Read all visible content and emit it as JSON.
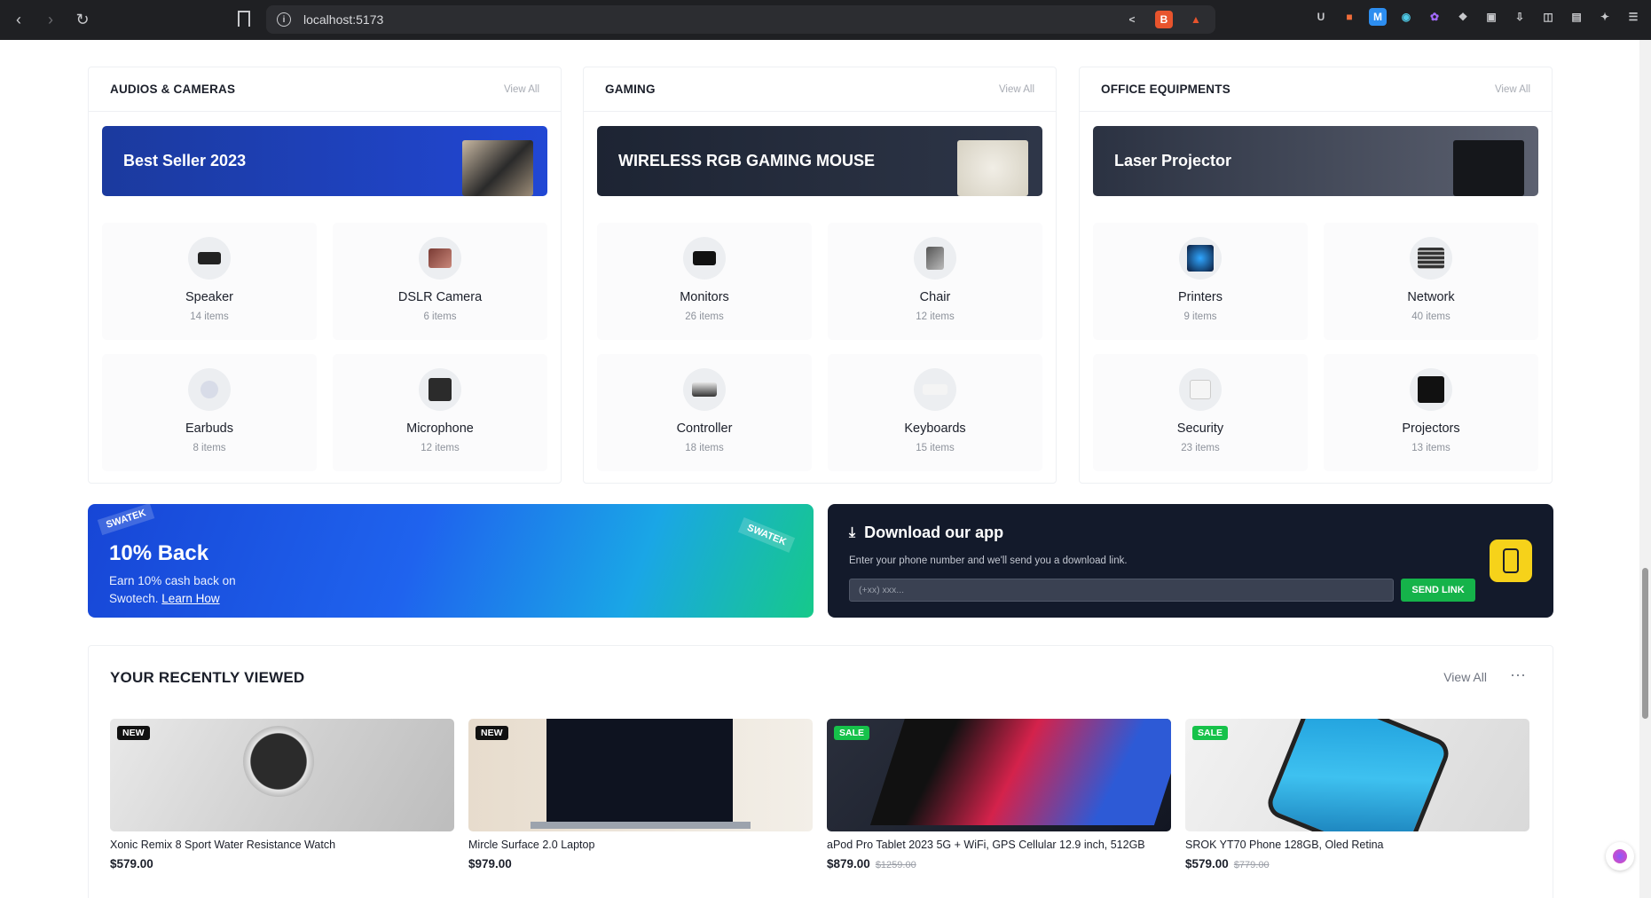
{
  "browser": {
    "url": "localhost:5173"
  },
  "categories": [
    {
      "title": "AUDIOS & CAMERAS",
      "view_all": "View All",
      "banner": "Best Seller 2023",
      "items": [
        {
          "name": "Speaker",
          "count": "14 items"
        },
        {
          "name": "DSLR Camera",
          "count": "6 items"
        },
        {
          "name": "Earbuds",
          "count": "8 items"
        },
        {
          "name": "Microphone",
          "count": "12 items"
        }
      ]
    },
    {
      "title": "GAMING",
      "view_all": "View All",
      "banner": "WIRELESS RGB GAMING MOUSE",
      "items": [
        {
          "name": "Monitors",
          "count": "26 items"
        },
        {
          "name": "Chair",
          "count": "12 items"
        },
        {
          "name": "Controller",
          "count": "18 items"
        },
        {
          "name": "Keyboards",
          "count": "15 items"
        }
      ]
    },
    {
      "title": "OFFICE EQUIPMENTS",
      "view_all": "View All",
      "banner": "Laser Projector",
      "items": [
        {
          "name": "Printers",
          "count": "9 items"
        },
        {
          "name": "Network",
          "count": "40 items"
        },
        {
          "name": "Security",
          "count": "23 items"
        },
        {
          "name": "Projectors",
          "count": "13 items"
        }
      ]
    }
  ],
  "promo": {
    "tag": "SWATEK",
    "title": "10% Back",
    "line1": "Earn 10% cash back on",
    "line2": "Swotech.",
    "link": "Learn How"
  },
  "app": {
    "title": "Download our app",
    "desc": "Enter your phone number and we'll send you a download link.",
    "placeholder": "(+xx) xxx...",
    "send": "SEND LINK"
  },
  "recent": {
    "title": "YOUR RECENTLY VIEWED",
    "view_all": "View All",
    "more": "···",
    "products": [
      {
        "badge": "NEW",
        "name": "Xonic Remix 8 Sport Water Resistance Watch",
        "price": "$579.00",
        "old": ""
      },
      {
        "badge": "NEW",
        "name": "Mircle Surface 2.0 Laptop",
        "price": "$979.00",
        "old": ""
      },
      {
        "badge": "SALE",
        "name": "aPod Pro Tablet 2023 5G + WiFi, GPS Cellular 12.9 inch, 512GB",
        "price": "$879.00",
        "old": "$1259.00"
      },
      {
        "badge": "SALE",
        "name": "SROK YT70 Phone 128GB, Oled Retina",
        "price": "$579.00",
        "old": "$779.00"
      }
    ]
  },
  "colors": {
    "accent_green": "#15b34a",
    "badge_new": "#111111",
    "badge_sale": "#16c24a",
    "promo_blue": "#1746d6",
    "app_bg": "#131a2b"
  }
}
